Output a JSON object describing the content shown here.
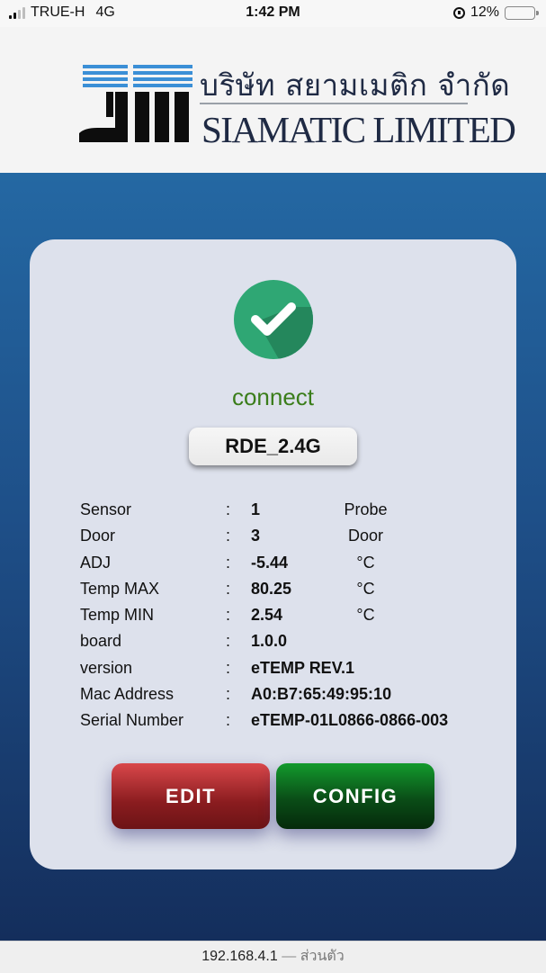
{
  "status_bar": {
    "carrier": "TRUE-H",
    "network": "4G",
    "time": "1:42 PM",
    "battery": "12%",
    "battery_level": 0.12
  },
  "header": {
    "company_thai": "บริษัท สยามเมติก จำกัด",
    "company_eng": "SIAMATIC LIMITED"
  },
  "card": {
    "status_text": "connect",
    "ssid": "RDE_2.4G",
    "info": [
      {
        "label": "Sensor",
        "value": "1",
        "unit": "Probe"
      },
      {
        "label": "Door",
        "value": "3",
        "unit": "Door"
      },
      {
        "label": "ADJ",
        "value": "-5.44",
        "unit": "°C"
      },
      {
        "label": "Temp MAX",
        "value": "80.25",
        "unit": "°C"
      },
      {
        "label": "Temp MIN",
        "value": "2.54",
        "unit": "°C"
      },
      {
        "label": "board",
        "value": "1.0.0",
        "unit": ""
      },
      {
        "label": "version",
        "value": "eTEMP REV.1",
        "unit": ""
      },
      {
        "label": "Mac Address",
        "value": "A0:B7:65:49:95:10",
        "unit": ""
      },
      {
        "label": "Serial Number",
        "value": "eTEMP-01L0866-0866-003",
        "unit": ""
      }
    ],
    "edit_label": "EDIT",
    "config_label": "CONFIG"
  },
  "url_bar": {
    "address": "192.168.4.1",
    "separator": "—",
    "mode": "ส่วนตัว"
  }
}
